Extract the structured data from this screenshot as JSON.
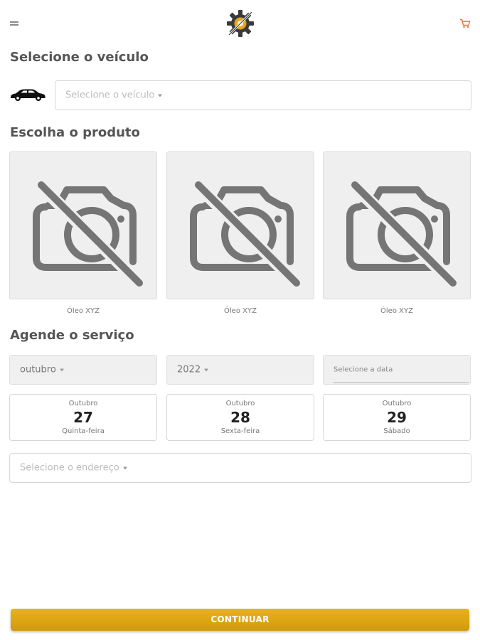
{
  "header": {
    "menu_icon": "hamburger-menu-icon",
    "logo_icon": "gear-with-wrench-logo",
    "cart_icon": "shopping-cart-icon",
    "accent_color": "#e6a817",
    "cart_color": "#e8703a"
  },
  "vehicle": {
    "title": "Selecione o veículo",
    "car_icon": "car-icon",
    "select_placeholder": "Selecione o veículo"
  },
  "products": {
    "title": "Escolha o produto",
    "image_icon": "no-photo-camera-icon",
    "items": [
      {
        "label": "Óleo XYZ"
      },
      {
        "label": "Óleo XYZ"
      },
      {
        "label": "Óleo XYZ"
      }
    ]
  },
  "schedule": {
    "title": "Agende o serviço",
    "month_value": "outubro",
    "year_value": "2022",
    "date_placeholder": "Selecione a data",
    "days": [
      {
        "month": "Outubro",
        "day": "27",
        "weekday": "Quinta-feira"
      },
      {
        "month": "Outubro",
        "day": "28",
        "weekday": "Sexta-feira"
      },
      {
        "month": "Outubro",
        "day": "29",
        "weekday": "Sábado"
      }
    ],
    "address_placeholder": "Selecione o endereço"
  },
  "footer": {
    "continue_label": "CONTINUAR"
  }
}
